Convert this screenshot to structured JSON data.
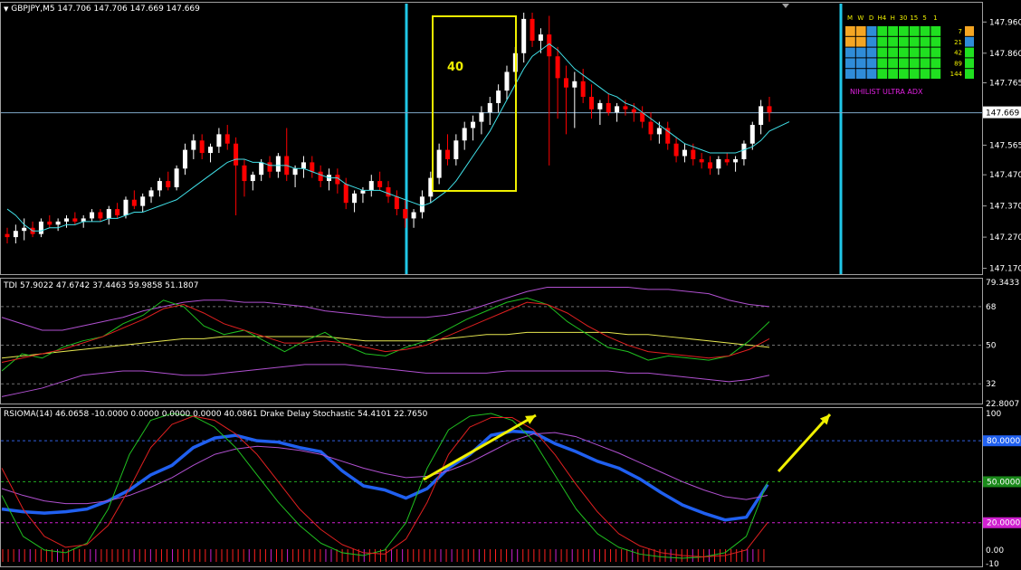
{
  "symbol_header": {
    "text": "GBPJPY,M5  147.706 147.706 147.669 147.669"
  },
  "box_label": "40",
  "price_pane": {
    "ticks": [
      "147.960",
      "147.860",
      "147.765",
      "147.565",
      "147.470",
      "147.370",
      "147.270",
      "147.170"
    ],
    "tick_values": [
      147.96,
      147.86,
      147.765,
      147.565,
      147.47,
      147.37,
      147.27,
      147.17
    ],
    "current_price": "147.669",
    "current_value": 147.669,
    "ylim": [
      147.16,
      147.99
    ]
  },
  "tdi_pane": {
    "title": "TDI 57.9022 47.6742 37.4463 59.9858 51.1807",
    "ticks": [
      "79.3433",
      "68",
      "50",
      "32",
      "22.8007"
    ],
    "tick_values": [
      79.3433,
      68,
      50,
      32,
      22.8007
    ],
    "ylim": [
      22.8007,
      79.3433
    ]
  },
  "rsioma_pane": {
    "title": "RSIOMA(14) 46.0658 -10.0000 0.0000 0.0000 0.0000 40.0861  Drake Delay Stochastic 54.4101 22.7650",
    "ticks": [
      "100",
      "80.0000",
      "50.0000",
      "20.0000",
      "0.00",
      "-10"
    ],
    "tick_values": [
      100,
      80,
      50,
      20,
      0,
      -10
    ],
    "ylim": [
      -10,
      100
    ]
  },
  "adx_panel": {
    "title": "NIHILIST ULTRA ADX",
    "timeframes": [
      "M",
      "W",
      "D",
      "H4",
      "H",
      "30",
      "15",
      "5",
      "1"
    ],
    "periods": [
      "7",
      "21",
      "42",
      "89",
      "144"
    ],
    "grid": [
      [
        "o",
        "o",
        "b",
        "g",
        "g",
        "g",
        "g",
        "g",
        "g"
      ],
      [
        "o",
        "o",
        "b",
        "g",
        "g",
        "g",
        "g",
        "g",
        "g"
      ],
      [
        "b",
        "b",
        "b",
        "g",
        "g",
        "g",
        "g",
        "g",
        "g"
      ],
      [
        "b",
        "b",
        "b",
        "g",
        "g",
        "g",
        "g",
        "g",
        "g"
      ],
      [
        "b",
        "b",
        "b",
        "g",
        "g",
        "g",
        "g",
        "g",
        "g"
      ]
    ],
    "row_end": [
      "o",
      "b",
      "g",
      "g",
      "g"
    ]
  },
  "colors": {
    "bull": "#ffffff",
    "bear": "#ff0000",
    "ma": "#40e0e8",
    "vline": "#20c8e8",
    "box": "#f0f000",
    "grid_orange": "#f5a623",
    "grid_blue": "#2f8cd8",
    "grid_green": "#20e020",
    "rsioma": "#2060f0",
    "adx_title": "#e020e0"
  },
  "chart_data": [
    {
      "type": "candlestick",
      "title": "GBPJPY,M5",
      "ylim": [
        147.16,
        147.99
      ],
      "candles": [
        [
          147.28,
          147.3,
          147.25,
          147.27
        ],
        [
          147.27,
          147.31,
          147.25,
          147.29
        ],
        [
          147.29,
          147.33,
          147.26,
          147.3
        ],
        [
          147.3,
          147.32,
          147.27,
          147.28
        ],
        [
          147.28,
          147.33,
          147.27,
          147.32
        ],
        [
          147.32,
          147.34,
          147.3,
          147.31
        ],
        [
          147.31,
          147.33,
          147.29,
          147.32
        ],
        [
          147.32,
          147.34,
          147.3,
          147.33
        ],
        [
          147.33,
          147.35,
          147.31,
          147.32
        ],
        [
          147.32,
          147.34,
          147.3,
          147.33
        ],
        [
          147.33,
          147.36,
          147.32,
          147.35
        ],
        [
          147.35,
          147.36,
          147.32,
          147.33
        ],
        [
          147.33,
          147.37,
          147.31,
          147.36
        ],
        [
          147.36,
          147.38,
          147.33,
          147.34
        ],
        [
          147.34,
          147.4,
          147.33,
          147.39
        ],
        [
          147.39,
          147.42,
          147.36,
          147.37
        ],
        [
          147.37,
          147.41,
          147.35,
          147.4
        ],
        [
          147.4,
          147.43,
          147.38,
          147.42
        ],
        [
          147.42,
          147.46,
          147.4,
          147.45
        ],
        [
          147.45,
          147.48,
          147.42,
          147.43
        ],
        [
          147.43,
          147.5,
          147.42,
          147.49
        ],
        [
          147.49,
          147.57,
          147.47,
          147.55
        ],
        [
          147.55,
          147.6,
          147.52,
          147.58
        ],
        [
          147.58,
          147.6,
          147.52,
          147.54
        ],
        [
          147.54,
          147.57,
          147.51,
          147.56
        ],
        [
          147.56,
          147.62,
          147.54,
          147.6
        ],
        [
          147.6,
          147.63,
          147.55,
          147.57
        ],
        [
          147.57,
          147.59,
          147.34,
          147.5
        ],
        [
          147.5,
          147.52,
          147.4,
          147.45
        ],
        [
          147.45,
          147.48,
          147.42,
          147.47
        ],
        [
          147.47,
          147.52,
          147.45,
          147.51
        ],
        [
          147.51,
          147.53,
          147.46,
          147.48
        ],
        [
          147.48,
          147.54,
          147.46,
          147.53
        ],
        [
          147.53,
          147.62,
          147.45,
          147.47
        ],
        [
          147.47,
          147.5,
          147.43,
          147.49
        ],
        [
          147.49,
          147.53,
          147.46,
          147.51
        ],
        [
          147.51,
          147.53,
          147.46,
          147.48
        ],
        [
          147.48,
          147.5,
          147.43,
          147.45
        ],
        [
          147.45,
          147.49,
          147.42,
          147.47
        ],
        [
          147.47,
          147.49,
          147.41,
          147.44
        ],
        [
          147.44,
          147.46,
          147.36,
          147.38
        ],
        [
          147.38,
          147.42,
          147.35,
          147.41
        ],
        [
          147.41,
          147.43,
          147.38,
          147.42
        ],
        [
          147.42,
          147.47,
          147.4,
          147.45
        ],
        [
          147.45,
          147.48,
          147.42,
          147.43
        ],
        [
          147.43,
          147.45,
          147.38,
          147.4
        ],
        [
          147.4,
          147.42,
          147.34,
          147.36
        ],
        [
          147.36,
          147.39,
          147.3,
          147.33
        ],
        [
          147.33,
          147.36,
          147.3,
          147.35
        ],
        [
          147.35,
          147.42,
          147.33,
          147.4
        ],
        [
          147.4,
          147.48,
          147.38,
          147.46
        ],
        [
          147.46,
          147.57,
          147.44,
          147.55
        ],
        [
          147.55,
          147.6,
          147.5,
          147.52
        ],
        [
          147.52,
          147.6,
          147.5,
          147.58
        ],
        [
          147.58,
          147.64,
          147.55,
          147.62
        ],
        [
          147.62,
          147.66,
          147.58,
          147.64
        ],
        [
          147.64,
          147.69,
          147.6,
          147.67
        ],
        [
          147.67,
          147.72,
          147.63,
          147.7
        ],
        [
          147.7,
          147.76,
          147.67,
          147.74
        ],
        [
          147.74,
          147.82,
          147.71,
          147.8
        ],
        [
          147.8,
          147.88,
          147.77,
          147.86
        ],
        [
          147.86,
          147.99,
          147.83,
          147.97
        ],
        [
          147.97,
          147.99,
          147.88,
          147.9
        ],
        [
          147.9,
          147.94,
          147.86,
          147.92
        ],
        [
          147.92,
          147.98,
          147.5,
          147.85
        ],
        [
          147.85,
          147.88,
          147.65,
          147.78
        ],
        [
          147.78,
          147.82,
          147.6,
          147.75
        ],
        [
          147.75,
          147.8,
          147.62,
          147.77
        ],
        [
          147.77,
          147.81,
          147.7,
          147.72
        ],
        [
          147.72,
          147.76,
          147.65,
          147.68
        ],
        [
          147.68,
          147.71,
          147.63,
          147.7
        ],
        [
          147.7,
          147.73,
          147.66,
          147.67
        ],
        [
          147.67,
          147.7,
          147.64,
          147.69
        ],
        [
          147.69,
          147.71,
          147.66,
          147.68
        ],
        [
          147.68,
          147.7,
          147.64,
          147.67
        ],
        [
          147.67,
          147.69,
          147.62,
          147.64
        ],
        [
          147.64,
          147.67,
          147.58,
          147.6
        ],
        [
          147.6,
          147.64,
          147.57,
          147.62
        ],
        [
          147.62,
          147.64,
          147.55,
          147.57
        ],
        [
          147.57,
          147.59,
          147.51,
          147.53
        ],
        [
          147.53,
          147.57,
          147.51,
          147.55
        ],
        [
          147.55,
          147.57,
          147.5,
          147.52
        ],
        [
          147.52,
          147.54,
          147.49,
          147.51
        ],
        [
          147.51,
          147.53,
          147.47,
          147.49
        ],
        [
          147.49,
          147.53,
          147.47,
          147.52
        ],
        [
          147.52,
          147.54,
          147.5,
          147.51
        ],
        [
          147.51,
          147.53,
          147.48,
          147.52
        ],
        [
          147.52,
          147.58,
          147.5,
          147.57
        ],
        [
          147.57,
          147.64,
          147.55,
          147.63
        ],
        [
          147.63,
          147.71,
          147.6,
          147.69
        ],
        [
          147.69,
          147.72,
          147.64,
          147.67
        ]
      ],
      "ma_values": [
        147.36,
        147.34,
        147.31,
        147.29,
        147.29,
        147.3,
        147.3,
        147.31,
        147.31,
        147.32,
        147.32,
        147.32,
        147.33,
        147.33,
        147.34,
        147.35,
        147.35,
        147.36,
        147.37,
        147.38,
        147.39,
        147.41,
        147.43,
        147.45,
        147.47,
        147.49,
        147.51,
        147.52,
        147.52,
        147.51,
        147.51,
        147.5,
        147.5,
        147.5,
        147.49,
        147.49,
        147.48,
        147.47,
        147.46,
        147.46,
        147.44,
        147.43,
        147.42,
        147.42,
        147.42,
        147.41,
        147.4,
        147.39,
        147.38,
        147.37,
        147.38,
        147.4,
        147.42,
        147.45,
        147.49,
        147.53,
        147.57,
        147.61,
        147.66,
        147.71,
        147.76,
        147.81,
        147.85,
        147.87,
        147.89,
        147.87,
        147.84,
        147.81,
        147.79,
        147.77,
        147.75,
        147.73,
        147.72,
        147.7,
        147.69,
        147.67,
        147.65,
        147.63,
        147.61,
        147.59,
        147.57,
        147.56,
        147.55,
        147.54,
        147.54,
        147.54,
        147.54,
        147.55,
        147.56,
        147.58,
        147.61
      ]
    },
    {
      "type": "line",
      "title": "TDI",
      "ylim": [
        22.8007,
        79.3433
      ],
      "series": [
        {
          "name": "upper",
          "values": [
            63,
            60,
            57,
            57,
            59,
            61,
            63,
            66,
            68,
            70,
            71,
            71,
            70,
            70,
            69,
            68,
            66,
            65,
            64,
            63,
            63,
            63,
            64,
            66,
            69,
            72,
            75,
            77,
            77,
            77,
            77,
            77,
            76,
            76,
            75,
            74,
            71,
            69,
            68
          ]
        },
        {
          "name": "middle",
          "values": [
            44,
            45,
            46,
            47,
            48,
            49,
            50,
            51,
            52,
            53,
            53,
            54,
            54,
            54,
            54,
            54,
            54,
            53,
            52,
            52,
            52,
            52,
            53,
            54,
            55,
            55,
            56,
            56,
            56,
            56,
            56,
            55,
            55,
            54,
            53,
            52,
            51,
            50,
            49
          ]
        },
        {
          "name": "lower",
          "values": [
            26,
            28,
            30,
            33,
            36,
            37,
            38,
            38,
            37,
            36,
            36,
            37,
            38,
            39,
            40,
            41,
            41,
            41,
            40,
            39,
            38,
            37,
            37,
            37,
            37,
            38,
            38,
            38,
            38,
            38,
            38,
            37,
            37,
            36,
            35,
            34,
            33,
            34,
            36
          ]
        },
        {
          "name": "rsi",
          "values": [
            38,
            46,
            44,
            49,
            52,
            54,
            60,
            64,
            71,
            68,
            59,
            55,
            57,
            52,
            47,
            52,
            56,
            50,
            46,
            45,
            49,
            52,
            57,
            62,
            66,
            70,
            72,
            69,
            61,
            55,
            49,
            47,
            43,
            45,
            44,
            43,
            45,
            52,
            61
          ]
        },
        {
          "name": "signal",
          "values": [
            42,
            44,
            46,
            48,
            51,
            54,
            58,
            62,
            67,
            69,
            65,
            60,
            57,
            54,
            51,
            51,
            52,
            51,
            49,
            47,
            48,
            50,
            54,
            58,
            62,
            66,
            70,
            69,
            65,
            59,
            54,
            50,
            47,
            46,
            45,
            44,
            45,
            48,
            53
          ]
        }
      ]
    },
    {
      "type": "line",
      "title": "RSIOMA(14)",
      "ylim": [
        -10,
        100
      ],
      "series": [
        {
          "name": "RSIOMA",
          "values": [
            30,
            28,
            27,
            28,
            30,
            36,
            44,
            55,
            62,
            75,
            82,
            84,
            80,
            79,
            75,
            72,
            58,
            47,
            44,
            38,
            45,
            60,
            70,
            84,
            87,
            86,
            78,
            72,
            65,
            60,
            52,
            42,
            33,
            27,
            22,
            24,
            48
          ]
        },
        {
          "name": "slow",
          "values": [
            45,
            40,
            36,
            34,
            34,
            36,
            40,
            46,
            53,
            62,
            70,
            74,
            76,
            75,
            73,
            70,
            65,
            60,
            56,
            53,
            54,
            58,
            64,
            72,
            80,
            85,
            86,
            83,
            77,
            71,
            64,
            57,
            50,
            44,
            39,
            37,
            40
          ]
        },
        {
          "name": "stoch_k",
          "values": [
            40,
            10,
            0,
            -2,
            5,
            30,
            70,
            95,
            100,
            98,
            90,
            75,
            55,
            35,
            18,
            5,
            -2,
            -4,
            0,
            20,
            60,
            88,
            98,
            100,
            95,
            80,
            55,
            30,
            12,
            2,
            -3,
            -5,
            -6,
            -5,
            -2,
            10,
            50
          ]
        },
        {
          "name": "stoch_d",
          "values": [
            60,
            30,
            10,
            2,
            4,
            18,
            45,
            75,
            92,
            98,
            95,
            85,
            70,
            50,
            30,
            15,
            4,
            -2,
            -3,
            8,
            35,
            70,
            90,
            97,
            97,
            88,
            70,
            48,
            28,
            12,
            3,
            -2,
            -4,
            -5,
            -4,
            0,
            20
          ]
        }
      ]
    }
  ]
}
